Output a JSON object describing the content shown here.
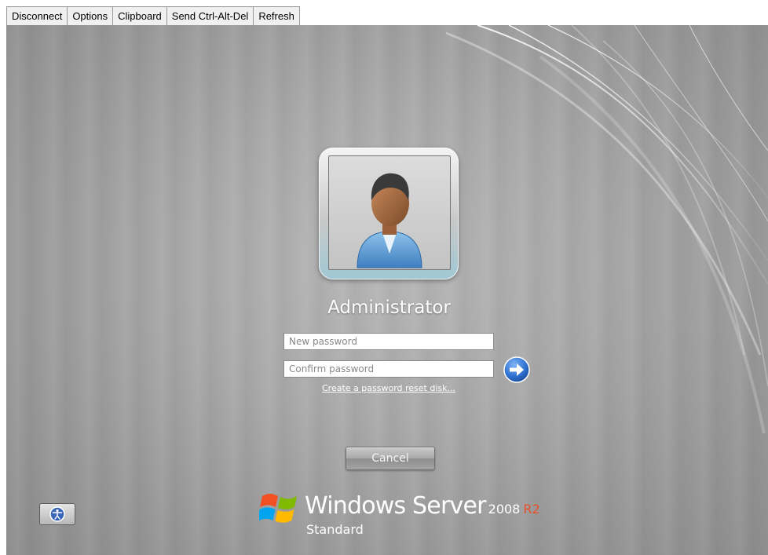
{
  "toolbar": {
    "buttons": [
      "Disconnect",
      "Options",
      "Clipboard",
      "Send Ctrl-Alt-Del",
      "Refresh"
    ]
  },
  "login": {
    "user_name": "Administrator",
    "new_password_placeholder": "New password",
    "confirm_password_placeholder": "Confirm password",
    "reset_link": "Create a password reset disk...",
    "cancel_label": "Cancel"
  },
  "branding": {
    "product": "Windows Server",
    "version": "2008",
    "release": "R2",
    "edition": "Standard",
    "release_color": "#e8512a"
  },
  "icons": {
    "user_tile": "user-avatar-icon",
    "submit": "arrow-right-icon",
    "ease_of_access": "ease-of-access-icon",
    "logo": "windows-logo-icon"
  },
  "colors": {
    "arrow_blue": "#2d6fd0",
    "background_gray": "#a8a8a8"
  }
}
